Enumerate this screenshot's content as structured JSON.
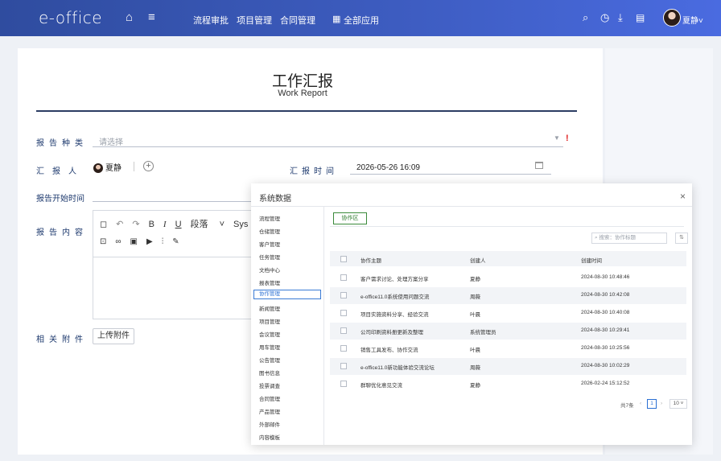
{
  "topbar": {
    "logo": "e-office",
    "home_icon": "home-icon",
    "menu_icon": "hamburger-menu-icon",
    "nav": [
      "流程审批",
      "项目管理",
      "合同管理"
    ],
    "apps_label": "全部应用",
    "apps_icon": "grid-icon",
    "right_icons": [
      "search-icon",
      "clock-icon",
      "download-icon",
      "document-icon"
    ],
    "user_name": "夏静",
    "brand_color": "#3a57b5"
  },
  "form": {
    "title": "工作汇报",
    "subtitle": "Work Report",
    "report_type_label": "报告种类",
    "report_type_placeholder": "请选择",
    "required_mark": "!",
    "reporter_label": "汇报人",
    "reporter_name": "夏静",
    "report_time_label": "汇报时间",
    "report_time_value": "2026-05-26 16:09",
    "start_time_label": "报告开始时间",
    "content_label": "报告内容",
    "paragraph_label": "段落",
    "font_label": "Sys",
    "attachments_label": "相关附件",
    "upload_label": "上传附件"
  },
  "modal": {
    "title": "系统数据",
    "close": "×",
    "sidebar": [
      "流程管理",
      "仓储管理",
      "客户管理",
      "任务管理",
      "文档中心",
      "报表管理",
      "协作管理",
      "新闻管理",
      "项目管理",
      "会议管理",
      "用车管理",
      "公告管理",
      "图书信息",
      "投票调查",
      "合同管理",
      "产品管理",
      "外部邮件",
      "内容模板"
    ],
    "active_sidebar": "协作管理",
    "tab": "协作区",
    "search_placeholder": "搜索：协作标题",
    "columns": [
      "协作主题",
      "创建人",
      "创建时间"
    ],
    "rows": [
      [
        "客户需求讨论、处理方案分享",
        "夏静",
        "2024-08-30 10:48:46"
      ],
      [
        "e-office11.0系统使用问题交流",
        "周薇",
        "2024-08-30 10:42:08"
      ],
      [
        "项目实施资料分享、经验交流",
        "叶晨",
        "2024-08-30 10:40:08"
      ],
      [
        "公司印刷资料册更新及整理",
        "系统管理员",
        "2024-08-30 10:29:41"
      ],
      [
        "销售工具发布、协作交流",
        "叶晨",
        "2024-08-30 10:25:56"
      ],
      [
        "e-office11.0新功能体验交流论坛",
        "周薇",
        "2024-08-30 10:02:29"
      ],
      [
        "群聊优化意见交流",
        "夏静",
        "2026-02-24 15:12:52"
      ]
    ],
    "pager": {
      "total": "共7条",
      "page": "1",
      "size": "10"
    }
  }
}
